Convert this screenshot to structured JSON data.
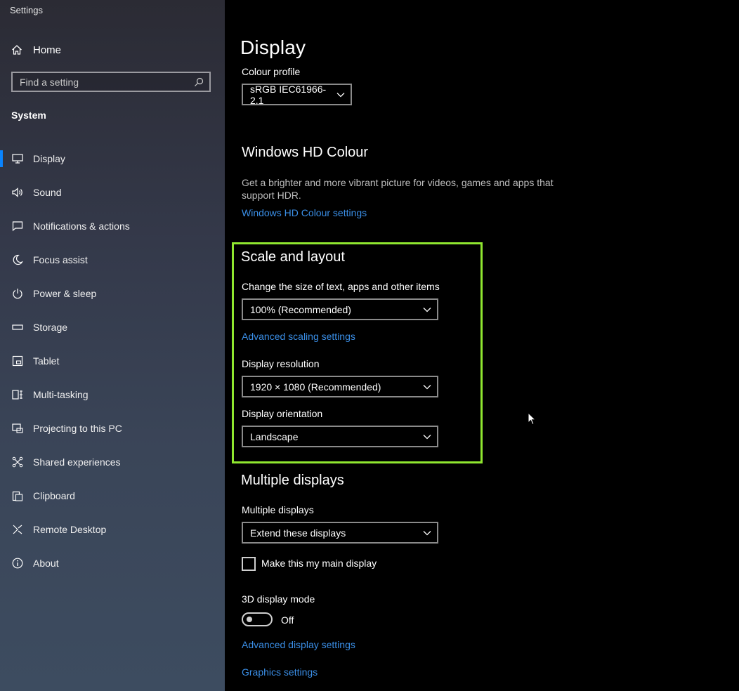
{
  "window": {
    "title": "Settings"
  },
  "sidebar": {
    "home_label": "Home",
    "search_placeholder": "Find a setting",
    "section": "System",
    "items": [
      {
        "label": "Display",
        "icon": "monitor-icon",
        "active": true
      },
      {
        "label": "Sound",
        "icon": "speaker-icon"
      },
      {
        "label": "Notifications & actions",
        "icon": "notification-icon"
      },
      {
        "label": "Focus assist",
        "icon": "moon-icon"
      },
      {
        "label": "Power & sleep",
        "icon": "power-icon"
      },
      {
        "label": "Storage",
        "icon": "storage-icon"
      },
      {
        "label": "Tablet",
        "icon": "tablet-icon"
      },
      {
        "label": "Multi-tasking",
        "icon": "multitasking-icon"
      },
      {
        "label": "Projecting to this PC",
        "icon": "projecting-icon"
      },
      {
        "label": "Shared experiences",
        "icon": "shared-icon"
      },
      {
        "label": "Clipboard",
        "icon": "clipboard-icon"
      },
      {
        "label": "Remote Desktop",
        "icon": "remote-desktop-icon"
      },
      {
        "label": "About",
        "icon": "info-icon"
      }
    ]
  },
  "main": {
    "title": "Display",
    "colour_profile": {
      "label": "Colour profile",
      "value": "sRGB IEC61966-2.1"
    },
    "hd_colour": {
      "heading": "Windows HD Colour",
      "description": "Get a brighter and more vibrant picture for videos, games and apps that support HDR.",
      "link": "Windows HD Colour settings"
    },
    "scale_layout": {
      "heading": "Scale and layout",
      "size_label": "Change the size of text, apps and other items",
      "size_value": "100% (Recommended)",
      "advanced_link": "Advanced scaling settings",
      "resolution_label": "Display resolution",
      "resolution_value": "1920 × 1080 (Recommended)",
      "orientation_label": "Display orientation",
      "orientation_value": "Landscape"
    },
    "multiple_displays": {
      "heading": "Multiple displays",
      "label": "Multiple displays",
      "value": "Extend these displays",
      "checkbox_label": "Make this my main display",
      "checkbox_checked": false
    },
    "three_d": {
      "label": "3D display mode",
      "toggle_state": "Off"
    },
    "links": {
      "advanced_display": "Advanced display settings",
      "graphics": "Graphics settings"
    }
  },
  "colors": {
    "accent_link": "#3a8ee6",
    "highlight_border": "#8fe62f",
    "active_indicator": "#0a84ff"
  }
}
